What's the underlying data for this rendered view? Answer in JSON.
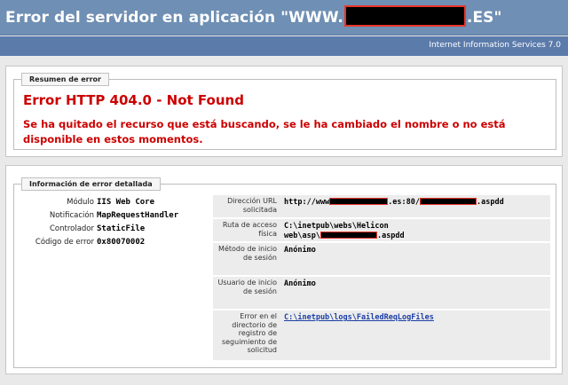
{
  "header": {
    "title_prefix": "Error del servidor en aplicación \"WWW.",
    "title_suffix": ".ES\"",
    "server": "Internet Information Services 7.0"
  },
  "summary": {
    "legend": "Resumen de error",
    "title": "Error HTTP 404.0 - Not Found",
    "description": "Se ha quitado el recurso que está buscando, se le ha cambiado el nombre o no está disponible en estos momentos."
  },
  "detail": {
    "legend": "Información de error detallada",
    "left_rows": [
      {
        "key": "Módulo",
        "value": "IIS Web Core"
      },
      {
        "key": "Notificación",
        "value": "MapRequestHandler"
      },
      {
        "key": "Controlador",
        "value": "StaticFile"
      },
      {
        "key": "Código de error",
        "value": "0x80070002"
      }
    ],
    "right_rows": [
      {
        "key": "Dirección URL solicitada",
        "value_parts": [
          "http://www",
          ".es:80/",
          ".aspdd"
        ]
      },
      {
        "key": "Ruta de acceso física",
        "value_line1": "C:\\inetpub\\webs\\Helicon",
        "value_line2_parts": [
          "web\\asp\\",
          ".aspdd"
        ]
      },
      {
        "key": "Método de inicio de sesión",
        "value": "Anónimo"
      },
      {
        "key": "Usuario de inicio de sesión",
        "value": "Anónimo"
      },
      {
        "key": "Error en el directorio de registro de seguimiento de solicitud",
        "value": "C:\\inetpub\\logs\\FailedReqLogFiles"
      }
    ]
  },
  "colors": {
    "header_bg": "#6f8fb4",
    "subheader_bg": "#5b7bab",
    "error_red": "#cc0000",
    "link_blue": "#1c3fa8",
    "redaction_border": "#e8352a"
  }
}
